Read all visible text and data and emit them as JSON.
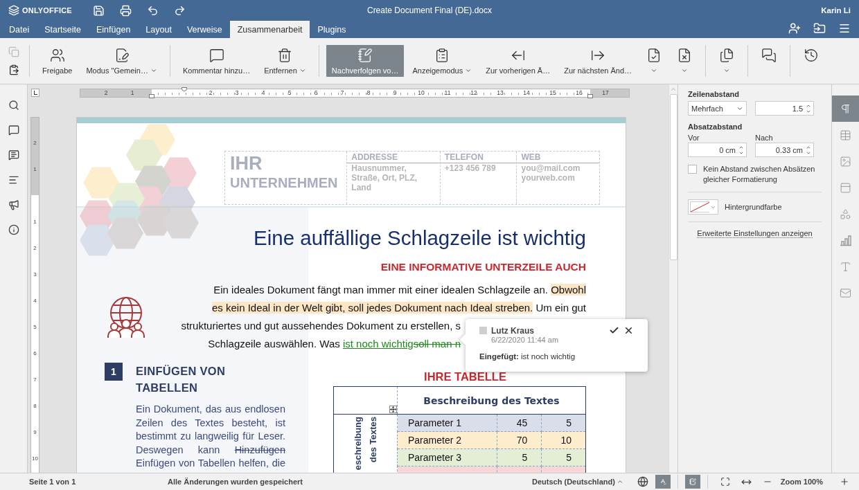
{
  "app": {
    "logo": "ONLYOFFICE",
    "title": "Create Document Final (DE).docx",
    "user": "Karin Li"
  },
  "menu_tabs": [
    {
      "label": "Datei",
      "selected": false
    },
    {
      "label": "Startseite",
      "selected": false
    },
    {
      "label": "Einfügen",
      "selected": false
    },
    {
      "label": "Layout",
      "selected": false
    },
    {
      "label": "Verweise",
      "selected": false
    },
    {
      "label": "Zusammenarbeit",
      "selected": true
    },
    {
      "label": "Plugins",
      "selected": false
    }
  ],
  "toolbar": {
    "clipboard": [
      {
        "disabled": true
      },
      {
        "disabled": false
      }
    ],
    "groups": [
      [
        {
          "label": "Freigabe",
          "caret": false,
          "selected": false
        },
        {
          "label": "Modus \"Gemein…",
          "caret": true,
          "selected": false
        }
      ],
      [
        {
          "label": "Kommentar hinzu…",
          "caret": false,
          "selected": false
        },
        {
          "label": "Entfernen",
          "caret": true,
          "selected": false
        }
      ],
      [
        {
          "label": "Nachverfolgen vo…",
          "caret": false,
          "selected": true
        },
        {
          "label": "Anzeigemodus",
          "caret": true,
          "selected": false
        },
        {
          "label": "Zur vorherigen Ä…",
          "caret": false,
          "selected": false
        },
        {
          "label": "Zur nächsten Änd…",
          "caret": false,
          "selected": false
        },
        {
          "caret": true,
          "selected": false
        },
        {
          "caret": true,
          "selected": false
        }
      ],
      [
        {
          "caret": true,
          "selected": false
        }
      ],
      [
        {
          "caret": false,
          "selected": false
        }
      ],
      [
        {
          "caret": false,
          "selected": false
        }
      ]
    ]
  },
  "ruler": {
    "left_numbers": [
      "2",
      "1"
    ],
    "numbers": [
      "2",
      "3",
      "4",
      "5",
      "6",
      "7",
      "8",
      "9",
      "10",
      "11",
      "12",
      "13",
      "14",
      "15",
      "16"
    ],
    "right_numbers": [
      "17"
    ],
    "vertical_top_numbers": [
      "2",
      "1"
    ],
    "vertical_numbers": [
      "1",
      "2",
      "3",
      "4",
      "5",
      "6",
      "7",
      "8",
      "9",
      "10"
    ]
  },
  "document": {
    "company": [
      "IHR",
      "UNTERNEHMEN"
    ],
    "contacts": [
      {
        "heading": "ADDRESSE",
        "lines": [
          "Hausnummer,",
          "Straße, Ort, PLZ,",
          "Land"
        ]
      },
      {
        "heading": "TELEFON",
        "lines": [
          "+123 456 789"
        ]
      },
      {
        "heading": "WEB",
        "lines": [
          "you@mail.com",
          "yourweb.com"
        ]
      }
    ],
    "headline": "Eine auffällige Schlagzeile ist wichtig",
    "subheading": "EINE INFORMATIVE UNTERZEILE AUCH",
    "intro": [
      {
        "covered": false,
        "segments": [
          {
            "kind": "plain",
            "text": "Ein ideales Dokument fängt man immer mit einer idealen Schlagzeile an. "
          },
          {
            "kind": "highlight",
            "text": "Obwohl"
          }
        ]
      },
      {
        "covered": false,
        "segments": [
          {
            "kind": "highlight",
            "text": "es kein Ideal in der Welt gibt, soll jedes Dokument nach Ideal streben."
          },
          {
            "kind": "plain",
            "text": " Um ein gut"
          }
        ]
      },
      {
        "covered": true,
        "segments": [
          {
            "kind": "plain",
            "text": "strukturiertes und gut aussehendes Dokument zu erstellen, s"
          }
        ]
      },
      {
        "covered": true,
        "segments": [
          {
            "kind": "plain",
            "text": "Schlagzeile auswählen. Was "
          },
          {
            "kind": "inserted",
            "text": "ist noch wichtig"
          },
          {
            "kind": "deleted",
            "text": "soll man n"
          }
        ]
      }
    ],
    "comment": {
      "author": "Lutz Kraus",
      "date": "6/22/2020 11:44 am",
      "text": "**Eingefügt:** ist noch wichtig"
    },
    "section": {
      "number": "1",
      "heading": "EINFÜGEN VON TABELLEN",
      "body": [
        {
          "kind": "plain",
          "text": "Ein Dokument, das aus endlosen Zeilen des Textes besteht, ist bestimmt zu langweilig für Leser. Deswegen kann "
        },
        {
          "kind": "struck",
          "text": "Hinzufügen"
        },
        {
          "kind": "plain",
          "text": " Einfügen von Tabellen helfen, die"
        }
      ]
    },
    "table": {
      "title": "IHRE TABELLE",
      "header": "Beschreibung des Textes",
      "side_header": [
        "eschreibung",
        "des Textes"
      ],
      "rows": [
        {
          "cells": [
            "Parameter 1",
            "45",
            "5"
          ],
          "color": "#d9deea"
        },
        {
          "cells": [
            "Parameter 2",
            "70",
            "10"
          ],
          "color": "#fdedcd"
        },
        {
          "cells": [
            "Parameter 3",
            "5",
            "5"
          ],
          "color": "#e3eed5"
        },
        {
          "color": "#f6d6d6"
        }
      ]
    }
  },
  "right_panel": {
    "line_spacing": {
      "label": "Zeilenabstand",
      "mode": "Mehrfach",
      "value": "1.5"
    },
    "paragraph_spacing": {
      "label": "Absatzabstand",
      "before_label": "Vor",
      "before": "0 cm",
      "after_label": "Nach",
      "after": "0.33 cm"
    },
    "no_spacing": {
      "label": "Kein Abstand zwischen Absätzen gleicher Formatierung",
      "checked": false
    },
    "background": {
      "label": "Hintergrundfarbe"
    },
    "advanced_link": "Erweiterte Einstellungen anzeigen"
  },
  "right_tabs": [
    {
      "selected": true
    },
    {
      "selected": false
    },
    {
      "selected": false
    },
    {
      "selected": false
    },
    {
      "selected": false
    },
    {
      "selected": false
    },
    {
      "selected": false
    },
    {
      "selected": false
    }
  ],
  "status": {
    "page": "Seite 1 von 1",
    "save_state": "Alle Änderungen wurden gespeichert",
    "language": "Deutsch (Deutschland)",
    "spellcheck": true,
    "track_changes": true,
    "zoom": "Zoom 100%"
  }
}
